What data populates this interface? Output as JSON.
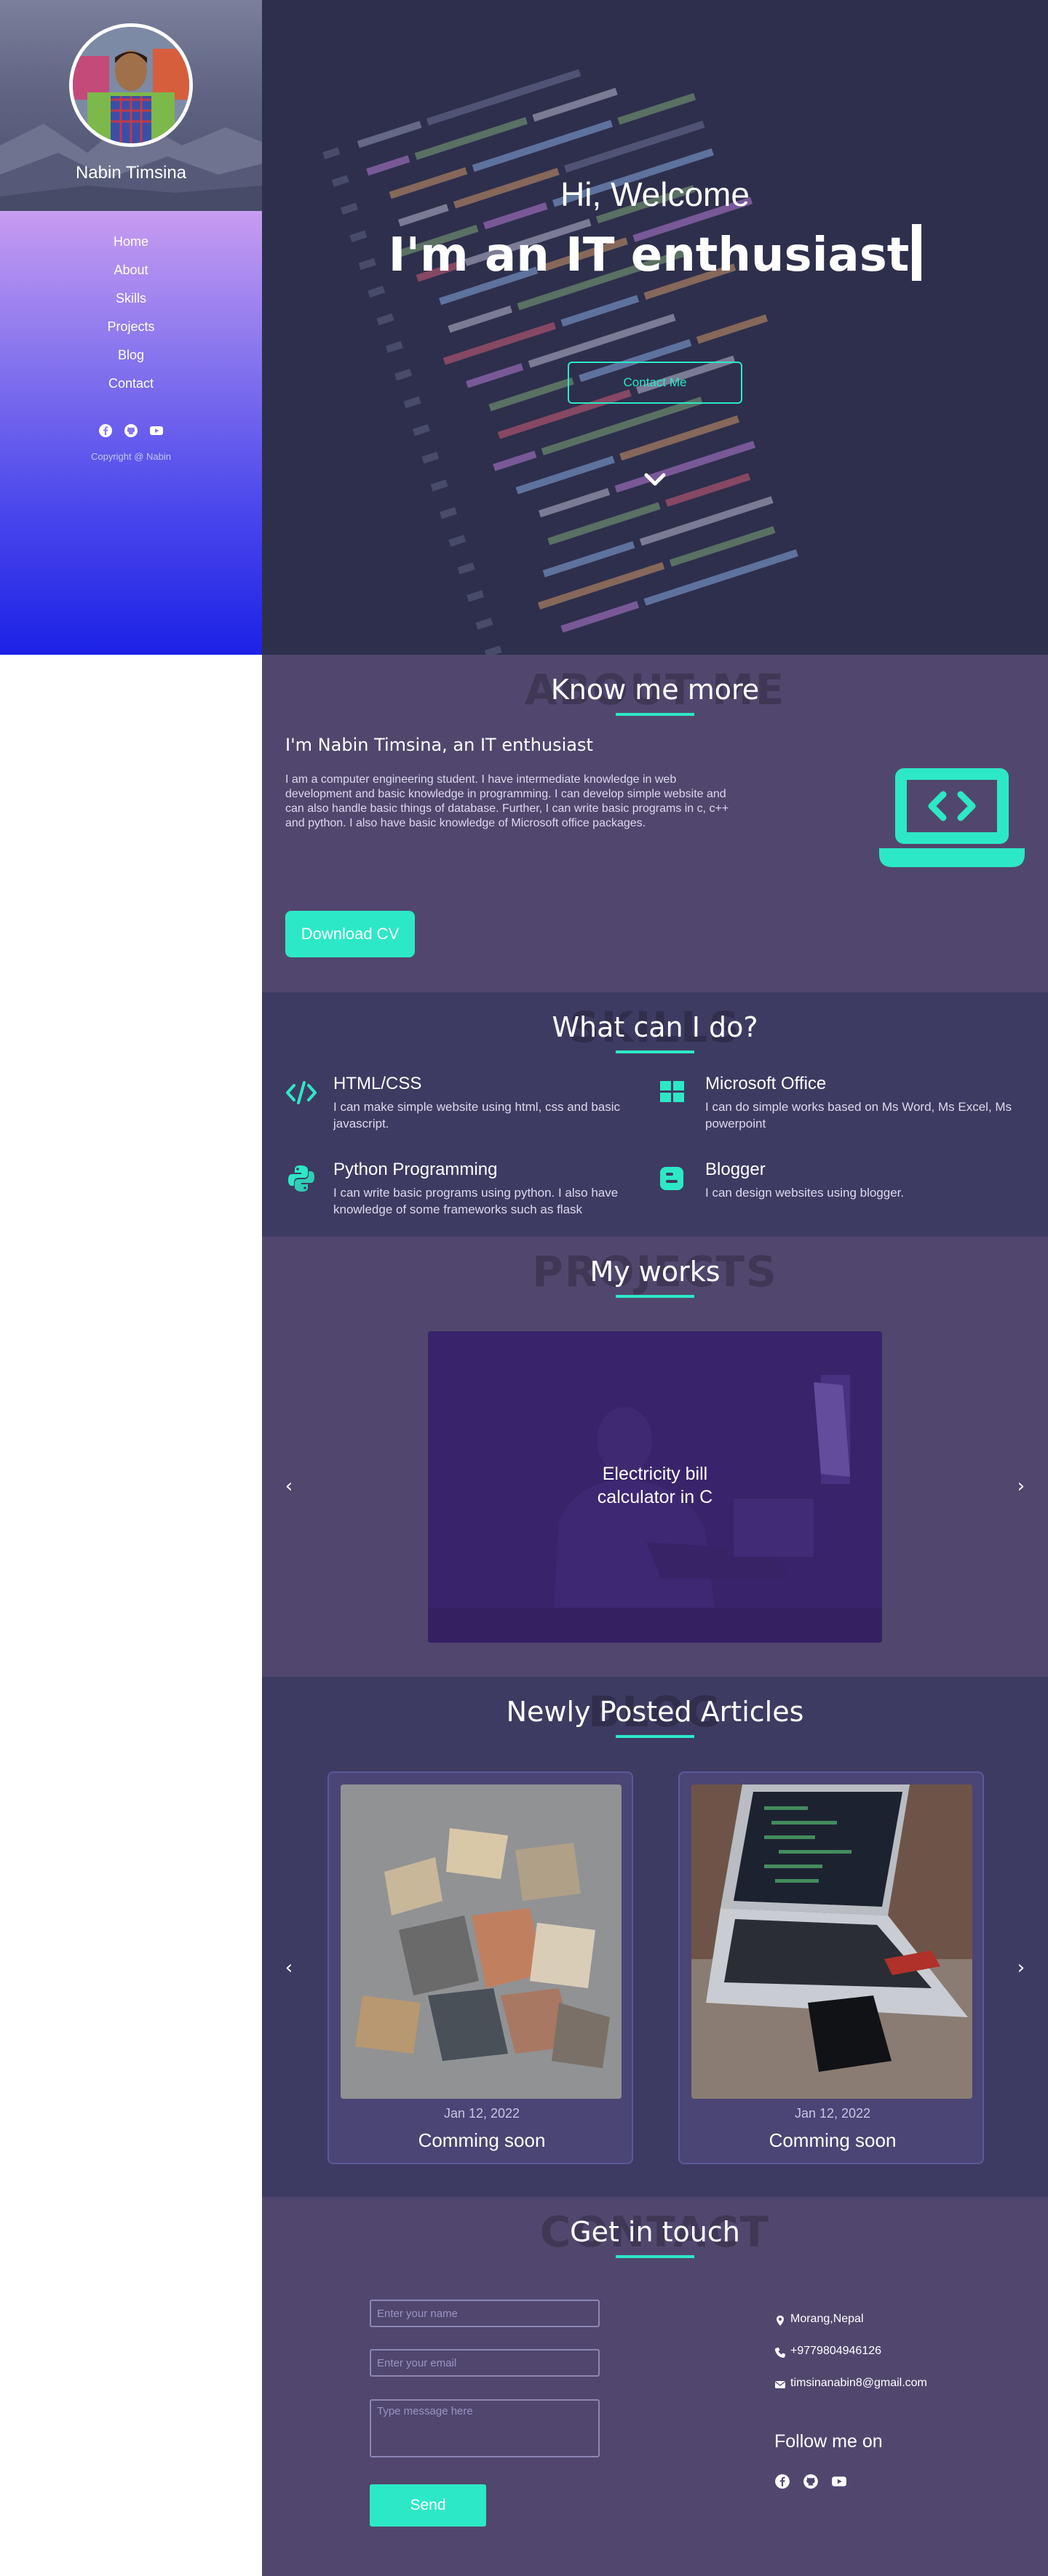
{
  "sidebar": {
    "name": "Nabin Timsina",
    "nav": [
      "Home",
      "About",
      "Skills",
      "Projects",
      "Blog",
      "Contact"
    ],
    "social_icons": [
      "facebook-icon",
      "github-icon",
      "youtube-icon"
    ],
    "copyright": "Copyright @ Nabin"
  },
  "hero": {
    "greeting": "Hi, Welcome",
    "title": "I'm an IT enthusiast",
    "contact_button": "Contact Me",
    "scroll_icon": "chevron-down-icon"
  },
  "about": {
    "ghost": "ABOUT ME",
    "title": "Know me more",
    "heading": "I'm Nabin Timsina, an IT enthusiast",
    "text": "I am a computer engineering student. I have intermediate knowledge in web development and basic knowledge in programming. I can develop simple website and can also handle basic things of database. Further, I can write basic programs in c, c++ and python. I also have basic knowledge of Microsoft office packages.",
    "download_button": "Download CV",
    "icon": "laptop-code-icon"
  },
  "skills": {
    "ghost": "SKILLS",
    "title": "What can I do?",
    "items": [
      {
        "name": "HTML/CSS",
        "desc": "I can make simple website using html, css and basic javascript.",
        "icon": "code-icon"
      },
      {
        "name": "Microsoft Office",
        "desc": "I can do simple works based on Ms Word, Ms Excel, Ms powerpoint",
        "icon": "windows-icon"
      },
      {
        "name": "Python Programming",
        "desc": "I can write basic programs using python. I also have knowledge of some frameworks such as flask",
        "icon": "python-icon"
      },
      {
        "name": "Blogger",
        "desc": "I can design websites using blogger.",
        "icon": "blogger-icon"
      }
    ]
  },
  "projects": {
    "ghost": "PROJECTS",
    "title": "My works",
    "card_title": "Electricity bill calculator in C",
    "prev": "‹",
    "next": "›"
  },
  "blog": {
    "ghost": "BLOG",
    "title": "Newly Posted Articles",
    "prev": "‹",
    "next": "›",
    "posts": [
      {
        "date": "Jan 12, 2022",
        "title": "Comming soon"
      },
      {
        "date": "Jan 12, 2022",
        "title": "Comming soon"
      }
    ]
  },
  "contact": {
    "ghost": "CONTACT",
    "title": "Get in touch",
    "name_placeholder": "Enter your name",
    "email_placeholder": "Enter your email",
    "message_placeholder": "Type message here",
    "send_button": "Send",
    "location": "Morang,Nepal",
    "phone": "+9779804946126",
    "email": "timsinanabin8@gmail.com",
    "follow_title": "Follow me on",
    "social_icons": [
      "facebook-icon",
      "github-icon",
      "youtube-icon"
    ]
  },
  "colors": {
    "accent": "#2de8c6",
    "about_bg": "#51476e",
    "skills_bg": "#3e3b62",
    "sidebar_top": "#c79cf1",
    "sidebar_bottom": "#1c22e6"
  }
}
